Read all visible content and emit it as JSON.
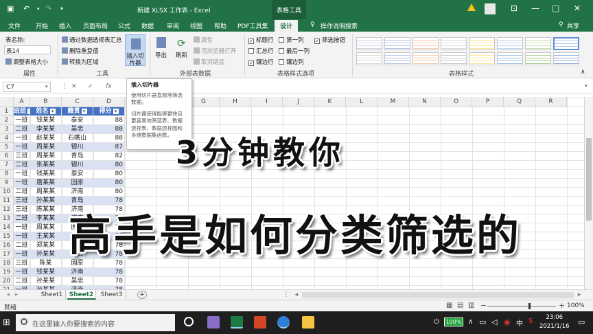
{
  "titlebar": {
    "title": "新建 XLSX 工作表 - Excel",
    "context_tab": "表格工具",
    "save_icon": "save-icon",
    "undo_icon": "undo-icon",
    "redo_icon": "redo-icon",
    "window_controls": [
      "—",
      "□",
      "✕"
    ]
  },
  "tabs": [
    "文件",
    "开始",
    "插入",
    "页面布局",
    "公式",
    "数据",
    "审阅",
    "视图",
    "帮助",
    "PDF工具集",
    "设计"
  ],
  "tell_me": "操作说明搜索",
  "share": "共享",
  "ribbon": {
    "properties": {
      "name_label": "表名称:",
      "name_value": "表14",
      "resize": "调整表格大小",
      "group": "属性"
    },
    "tools": {
      "pivot": "通过数据透视表汇总",
      "remove_dup": "删除重复值",
      "convert": "转换为区域",
      "slicer": "插入切片器",
      "group": "工具"
    },
    "external": {
      "export": "导出",
      "refresh": "刷新",
      "properties": "属性",
      "open_browser": "用浏览器打开",
      "unlink": "取消链接",
      "group": "外部表数据"
    },
    "style_options": {
      "header_row": "标题行",
      "total_row": "汇总行",
      "banded_rows": "镶边行",
      "first_col": "第一列",
      "last_col": "最后一列",
      "banded_cols": "镶边列",
      "filter_btn": "筛选按钮",
      "group": "表格样式选项",
      "checked": [
        true,
        false,
        true,
        false,
        false,
        false,
        true
      ]
    },
    "styles_group": "表格样式"
  },
  "formula_bar": {
    "cell_ref": "C7",
    "fx": "fx",
    "value": ""
  },
  "tooltip": {
    "title": "插入切片器",
    "line1": "使用切片器直观地筛选数据。",
    "line2": "切片器使得能够更快且更容易地筛选表、数据透视表、数据透视图和多维数据集函数。"
  },
  "columns": [
    "A",
    "B",
    "C",
    "D",
    "E",
    "F",
    "G",
    "H",
    "I",
    "J",
    "K",
    "L",
    "M",
    "N",
    "O",
    "P",
    "Q",
    "R"
  ],
  "table_headers": [
    "班组",
    "姓名",
    "籍贯",
    "得分"
  ],
  "rows": [
    [
      "一班",
      "钱某某",
      "泰安",
      "88"
    ],
    [
      "二班",
      "李某某",
      "吴忠",
      "88"
    ],
    [
      "一班",
      "赵某某",
      "石嘴山",
      "88"
    ],
    [
      "一班",
      "周某某",
      "银川",
      "87"
    ],
    [
      "三班",
      "周某某",
      "青岛",
      "82"
    ],
    [
      "二班",
      "张某某",
      "银川",
      "80"
    ],
    [
      "一班",
      "钱某某",
      "泰安",
      "80"
    ],
    [
      "一班",
      "唐某某",
      "固原",
      "80"
    ],
    [
      "二班",
      "周某某",
      "济南",
      "80"
    ],
    [
      "三班",
      "孙某某",
      "青岛",
      "78"
    ],
    [
      "三班",
      "陈某某",
      "济南",
      "78"
    ],
    [
      "二班",
      "李某某",
      "济南",
      "78"
    ],
    [
      "一班",
      "周某某",
      "固原",
      "78"
    ],
    [
      "一班",
      "王某某",
      "青岛",
      "78"
    ],
    [
      "二班",
      "郑某某",
      "吴忠",
      "78"
    ],
    [
      "一班",
      "孙某某",
      "青岛",
      "78"
    ],
    [
      "三班",
      "陈某",
      "固原",
      "78"
    ],
    [
      "一班",
      "钱某某",
      "济南",
      "78"
    ],
    [
      "二班",
      "孙某某",
      "吴忠",
      "78"
    ],
    [
      "一班",
      "孙某某",
      "济南",
      "78"
    ]
  ],
  "overlay": {
    "line1": "3分钟教你",
    "line2": "高手是如何分类筛选的"
  },
  "sheets": [
    "Sheet1",
    "Sheet2",
    "Sheet3"
  ],
  "active_sheet": "Sheet2",
  "status": {
    "ready": "就绪",
    "zoom": "100%",
    "zoom_fraction": 0.6
  },
  "taskbar": {
    "search_placeholder": "在这里输入你要搜索的内容",
    "battery": "100%",
    "time": "23:06",
    "date": "2021/1/16",
    "ime": "中"
  },
  "colors": {
    "excel_green": "#217346",
    "table_header": "#4472c4",
    "table_band": "#d9e1f2"
  }
}
